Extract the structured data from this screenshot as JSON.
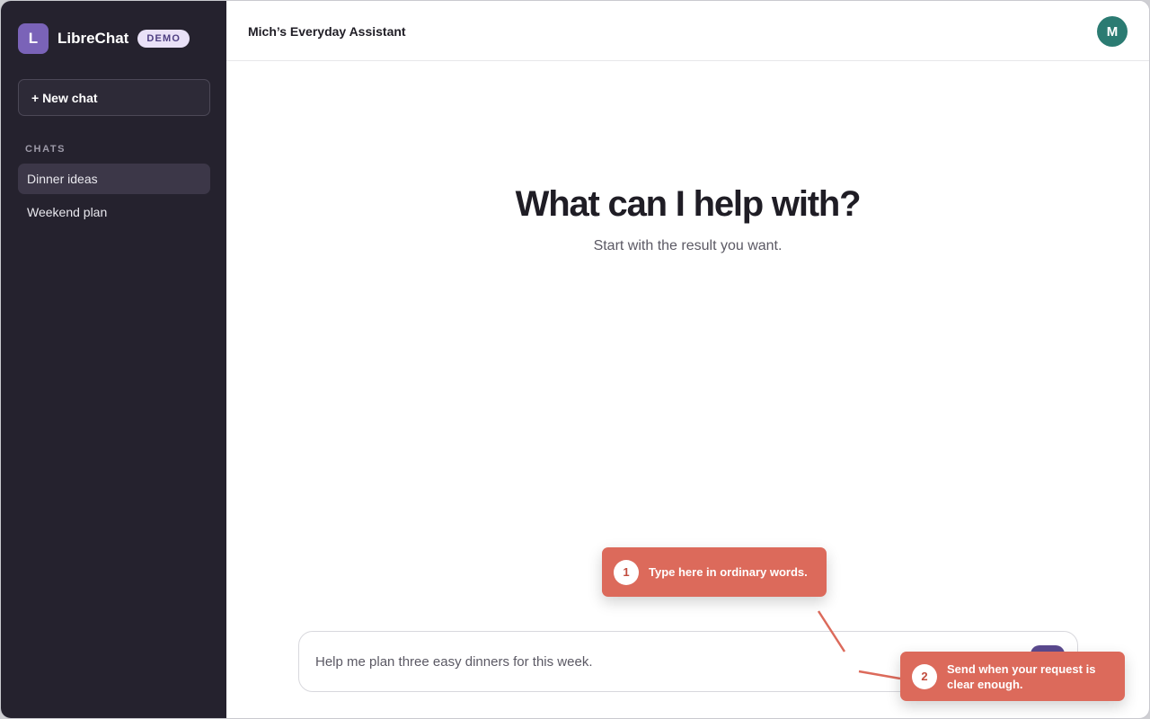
{
  "brand": {
    "logo_letter": "L",
    "name": "LibreChat",
    "badge": "DEMO"
  },
  "sidebar": {
    "new_chat_label": "+ New chat",
    "section_label": "CHATS",
    "chats": [
      {
        "label": "Dinner ideas",
        "active": true
      },
      {
        "label": "Weekend plan",
        "active": false
      }
    ]
  },
  "header": {
    "title": "Mich’s Everyday Assistant",
    "avatar_letter": "M"
  },
  "main": {
    "title": "What can I help with?",
    "subtitle": "Start with the result you want."
  },
  "composer": {
    "value": "Help me plan three easy dinners for this week."
  },
  "callouts": [
    {
      "number": "1",
      "text": "Type here in ordinary words."
    },
    {
      "number": "2",
      "text": "Send when your request is clear enough."
    }
  ],
  "colors": {
    "sidebar_bg": "#25222e",
    "accent": "#7a63b8",
    "send_button": "#5b4a8f",
    "avatar": "#2b7b72",
    "callout": "#dc6a5b"
  }
}
